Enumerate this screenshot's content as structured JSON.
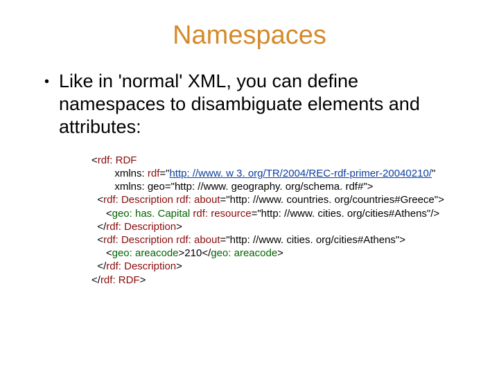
{
  "title": "Namespaces",
  "bullet": "Like in 'normal' XML, you can define namespaces to disambiguate elements and attributes:",
  "code": {
    "l1a": "<",
    "l1b": "rdf: RDF",
    "l2a": "        xmlns: ",
    "l2b": "rdf",
    "l2c": "=\"",
    "l2d": "http: //www. w 3. org/TR/2004/REC-rdf-primer-20040210/",
    "l2e": "\"",
    "l3": "        xmlns: geo=\"http: //www. geography. org/schema. rdf#\">",
    "l4a": "  <",
    "l4b": "rdf: Description",
    "l4c": " ",
    "l4d": "rdf: about",
    "l4e": "=\"http: //www. countries. org/countries#Greece\">",
    "l5a": "     <",
    "l5b": "geo: has. Capital",
    "l5c": " ",
    "l5d": "rdf: resource",
    "l5e": "=\"http: //www. cities. org/cities#Athens\"/>",
    "l6a": "  </",
    "l6b": "rdf: Description",
    "l6c": ">",
    "l7a": "  <",
    "l7b": "rdf: Description",
    "l7c": " ",
    "l7d": "rdf: about",
    "l7e": "=\"http: //www. cities. org/cities#Athens\">",
    "l8a": "     <",
    "l8b": "geo: areacode",
    "l8c": ">210</",
    "l8d": "geo: areacode",
    "l8e": ">",
    "l9a": "  </",
    "l9b": "rdf: Description",
    "l9c": ">",
    "l10a": "</",
    "l10b": "rdf: RDF",
    "l10c": ">"
  }
}
